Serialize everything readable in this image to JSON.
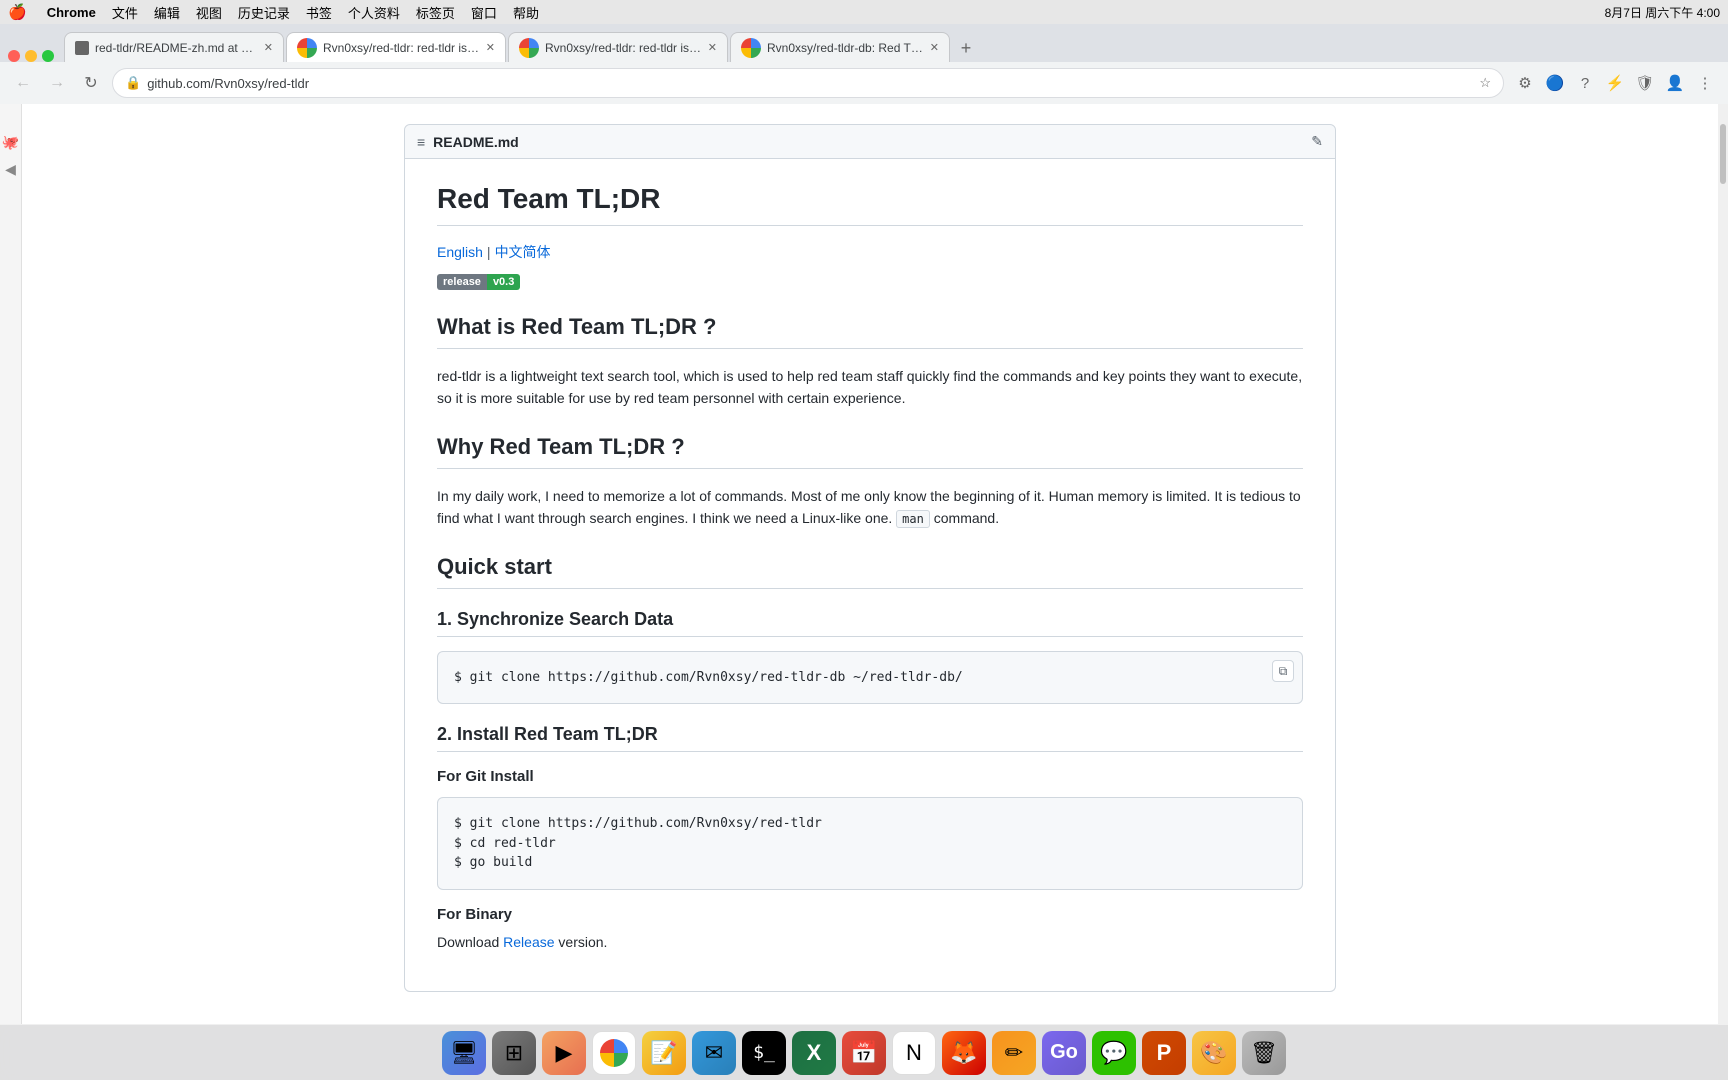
{
  "menubar": {
    "apple": "🍎",
    "app_name": "Chrome",
    "items": [
      "文件",
      "编辑",
      "视图",
      "历史记录",
      "书签",
      "个人资料",
      "标签页",
      "窗口",
      "帮助"
    ],
    "right_info": "8月7日 周六下午 4:00"
  },
  "tabs": [
    {
      "id": "tab1",
      "title": "red-tldr/README-zh.md at ma...",
      "active": false
    },
    {
      "id": "tab2",
      "title": "Rvn0xsy/red-tldr: red-tldr is a...",
      "active": true
    },
    {
      "id": "tab3",
      "title": "Rvn0xsy/red-tldr: red-tldr is a...",
      "active": false
    },
    {
      "id": "tab4",
      "title": "Rvn0xsy/red-tldr-db: Red TL;...",
      "active": false
    }
  ],
  "nav": {
    "url": "github.com/Rvn0xsy/red-tldr"
  },
  "file_header": {
    "icon": "≡",
    "name": "README.md",
    "edit_icon": "✎"
  },
  "page_title": "Red Team TL;DR",
  "lang_links": {
    "english": "English",
    "separator": "|",
    "chinese": "中文简体"
  },
  "badge": {
    "release": "release",
    "version": "v0.3"
  },
  "sections": {
    "what_is_title": "What is Red Team TL;DR ?",
    "what_is_body": "red-tldr is a lightweight text search tool, which is used to help red team staff quickly find the commands and key points they want to execute, so it is more suitable for use by red team personnel with certain experience.",
    "why_title": "Why Red Team TL;DR ?",
    "why_body1": "In my daily work, I need to memorize a lot of commands. Most of me only know the beginning of it. Human memory is limited. It is tedious to find what I want through search engines. I think we need a Linux-like one.",
    "why_code_inline": "man",
    "why_body2": "command.",
    "quick_start_title": "Quick start",
    "sync_title": "1. Synchronize Search Data",
    "sync_command": "$ git clone https://github.com/Rvn0xsy/red-tldr-db ~/red-tldr-db/",
    "install_title": "2. Install Red Team TL;DR",
    "git_install_label": "For Git Install",
    "git_commands": "$ git clone https://github.com/Rvn0xsy/red-tldr\n$ cd red-tldr\n$ go build",
    "binary_label": "For Binary",
    "download_text": "Download ",
    "release_link": "Release",
    "download_suffix": " version."
  }
}
